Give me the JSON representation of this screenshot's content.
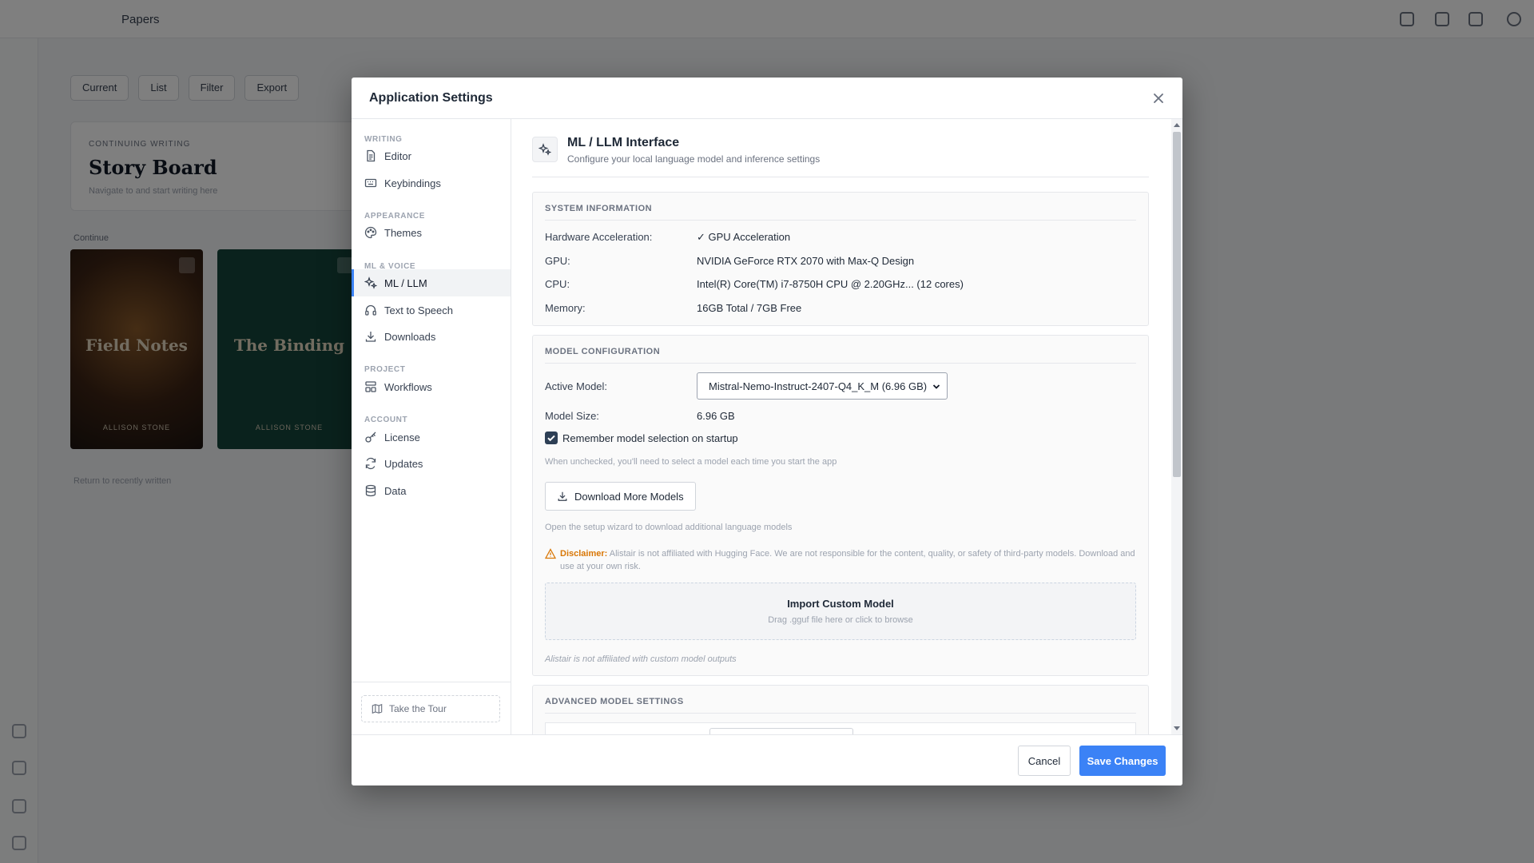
{
  "background_app": {
    "title": "Papers",
    "toolbar": [
      "Current",
      "List",
      "Filter",
      "Export"
    ],
    "board": {
      "eyebrow": "Continuing writing",
      "title": "Story Board",
      "subtitle": "Navigate to and start writing here"
    },
    "section_label": "Continue",
    "cards": [
      {
        "title": "Field Notes",
        "author": "ALLISON STONE"
      },
      {
        "title": "The Binding",
        "author": "ALLISON STONE"
      }
    ],
    "footer_note": "Return to recently written"
  },
  "modal": {
    "title": "Application Settings",
    "close_icon": "close-icon"
  },
  "sidebar": {
    "sections": [
      {
        "label": "WRITING",
        "items": [
          {
            "label": "Editor",
            "icon": "document-icon"
          },
          {
            "label": "Keybindings",
            "icon": "keyboard-icon"
          }
        ]
      },
      {
        "label": "APPEARANCE",
        "items": [
          {
            "label": "Themes",
            "icon": "palette-icon"
          }
        ]
      },
      {
        "label": "ML & VOICE",
        "items": [
          {
            "label": "ML / LLM",
            "icon": "sparkles-icon",
            "active": true
          },
          {
            "label": "Text to Speech",
            "icon": "headphones-icon"
          },
          {
            "label": "Downloads",
            "icon": "download-icon"
          }
        ]
      },
      {
        "label": "PROJECT",
        "items": [
          {
            "label": "Workflows",
            "icon": "workflow-icon"
          }
        ]
      },
      {
        "label": "ACCOUNT",
        "items": [
          {
            "label": "License",
            "icon": "key-icon"
          },
          {
            "label": "Updates",
            "icon": "refresh-icon"
          },
          {
            "label": "Data",
            "icon": "database-icon"
          }
        ]
      }
    ],
    "tour_label": "Take the Tour"
  },
  "page": {
    "title": "ML / LLM Interface",
    "subtitle": "Configure your local language model and inference settings"
  },
  "system_info": {
    "heading": "SYSTEM INFORMATION",
    "rows": [
      {
        "label": "Hardware Acceleration:",
        "value": "✓ GPU Acceleration"
      },
      {
        "label": "GPU:",
        "value": "NVIDIA GeForce RTX 2070 with Max-Q Design"
      },
      {
        "label": "CPU:",
        "value": "Intel(R) Core(TM) i7-8750H CPU @ 2.20GHz... (12 cores)"
      },
      {
        "label": "Memory:",
        "value": "16GB Total / 7GB Free"
      }
    ]
  },
  "model_config": {
    "heading": "MODEL CONFIGURATION",
    "active_model_label": "Active Model:",
    "active_model_value": "Mistral-Nemo-Instruct-2407-Q4_K_M (6.96 GB)",
    "model_size_label": "Model Size:",
    "model_size_value": "6.96 GB",
    "remember_label": "Remember model selection on startup",
    "remember_checked": true,
    "remember_help": "When unchecked, you'll need to select a model each time you start the app",
    "download_button": "Download More Models",
    "download_help": "Open the setup wizard to download additional language models",
    "disclaimer_label": "Disclaimer:",
    "disclaimer_text": " Alistair is not affiliated with Hugging Face. We are not responsible for the content, quality, or safety of third-party models. Download and use at your own risk.",
    "import_title": "Import Custom Model",
    "import_subtitle": "Drag .gguf file here or click to browse",
    "custom_note": "Alistair is not affiliated with custom model outputs"
  },
  "advanced": {
    "heading": "ADVANCED MODEL SETTINGS"
  },
  "footer": {
    "cancel": "Cancel",
    "save": "Save Changes"
  },
  "colors": {
    "primary": "#3b82f6",
    "warning": "#d97706",
    "overlay": "rgba(0,0,0,0.5)"
  }
}
